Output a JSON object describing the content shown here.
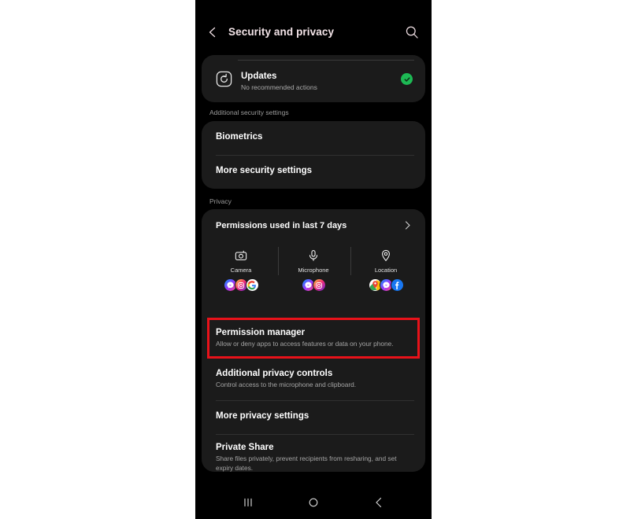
{
  "header": {
    "title": "Security and privacy",
    "back_icon": "back-chevron-icon",
    "search_icon": "search-icon"
  },
  "updates_card": {
    "icon": "updates-refresh-icon",
    "title": "Updates",
    "subtitle": "No recommended actions",
    "status_icon": "green-check-badge",
    "status_color": "#1db954"
  },
  "sections": {
    "additional_security_label": "Additional security settings",
    "privacy_label": "Privacy"
  },
  "security_card": {
    "rows": [
      {
        "title": "Biometrics"
      },
      {
        "title": "More security settings"
      }
    ]
  },
  "privacy_card": {
    "permissions_header": {
      "title": "Permissions used in last 7 days",
      "chevron_icon": "chevron-right-icon"
    },
    "permission_columns": [
      {
        "label": "Camera",
        "icon": "camera-icon",
        "apps": [
          {
            "name": "messenger",
            "color": "#a334fa"
          },
          {
            "name": "instagram",
            "color": "#e1306c"
          },
          {
            "name": "google",
            "color": "#ffffff"
          }
        ]
      },
      {
        "label": "Microphone",
        "icon": "microphone-icon",
        "apps": [
          {
            "name": "messenger",
            "color": "#a334fa"
          },
          {
            "name": "instagram",
            "color": "#e1306c"
          }
        ]
      },
      {
        "label": "Location",
        "icon": "location-pin-icon",
        "apps": [
          {
            "name": "google-maps",
            "color": "#ffffff"
          },
          {
            "name": "messenger",
            "color": "#a334fa"
          },
          {
            "name": "facebook",
            "color": "#1877f2"
          }
        ]
      }
    ],
    "rows": [
      {
        "title": "Permission manager",
        "subtitle": "Allow or deny apps to access features or data on your phone.",
        "highlighted": true
      },
      {
        "title": "Additional privacy controls",
        "subtitle": "Control access to the microphone and clipboard.",
        "highlighted": false
      },
      {
        "title": "More privacy settings",
        "subtitle": "",
        "highlighted": false
      },
      {
        "title": "Private Share",
        "subtitle": "Share files privately, prevent recipients from resharing, and set expiry dates.",
        "highlighted": false
      }
    ]
  },
  "annotation": {
    "target": "Permission manager",
    "color": "#e8121a"
  },
  "navbar": {
    "recents_icon": "recents-icon",
    "home_icon": "home-icon",
    "back_icon": "back-icon"
  }
}
